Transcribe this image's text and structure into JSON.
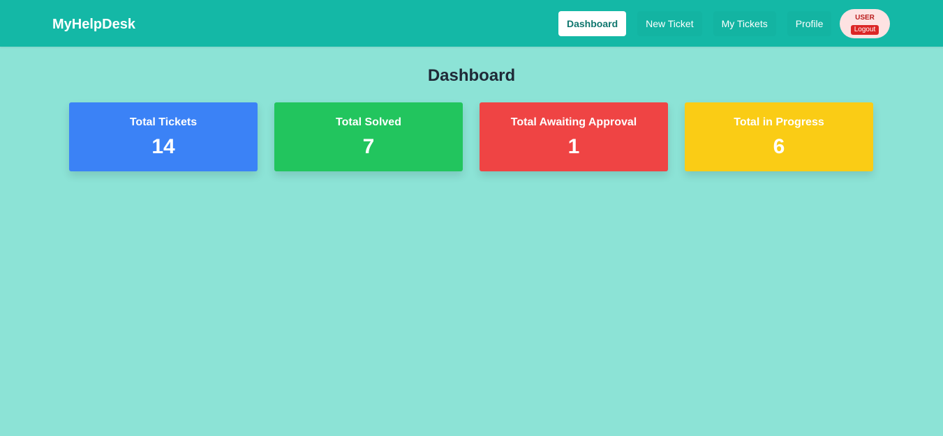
{
  "header": {
    "brand": "MyHelpDesk",
    "nav": [
      {
        "label": "Dashboard",
        "active": true
      },
      {
        "label": "New Ticket",
        "active": false
      },
      {
        "label": "My Tickets",
        "active": false
      },
      {
        "label": "Profile",
        "active": false
      }
    ],
    "user": {
      "role": "USER",
      "logout_label": "Logout"
    }
  },
  "main": {
    "title": "Dashboard",
    "cards": [
      {
        "label": "Total Tickets",
        "value": "14",
        "color": "#3b82f6"
      },
      {
        "label": "Total Solved",
        "value": "7",
        "color": "#22c55e"
      },
      {
        "label": "Total Awaiting Approval",
        "value": "1",
        "color": "#ef4444"
      },
      {
        "label": "Total in Progress",
        "value": "6",
        "color": "#facc15"
      }
    ]
  },
  "colors": {
    "header_bg": "#14b8a6",
    "page_bg": "#8ce3d6",
    "active_text": "#0f766e",
    "logout_bg": "#dc2626"
  }
}
